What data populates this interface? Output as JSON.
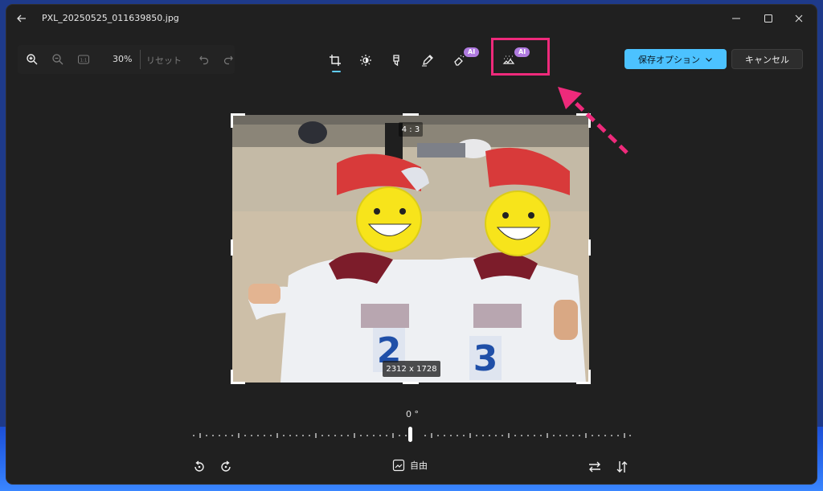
{
  "titlebar": {
    "filename": "PXL_20250525_011639850.jpg",
    "back_icon": "arrow-left-icon",
    "minimize_icon": "minimize-icon",
    "maximize_icon": "maximize-icon",
    "close_icon": "close-icon"
  },
  "zoom_toolbar": {
    "zoom_in_icon": "zoom-in-icon",
    "zoom_out_icon": "zoom-out-icon",
    "actual_size_icon": "actual-size-icon",
    "zoom_percent": "30%",
    "reset_label": "リセット",
    "undo_icon": "undo-icon",
    "redo_icon": "redo-icon"
  },
  "edit_tools": [
    {
      "name": "crop",
      "icon": "crop-icon",
      "active": true
    },
    {
      "name": "adjust",
      "icon": "brightness-icon"
    },
    {
      "name": "filter",
      "icon": "filter-icon"
    },
    {
      "name": "markup",
      "icon": "pen-icon"
    },
    {
      "name": "erase",
      "icon": "generative-erase-icon",
      "badge": "AI"
    },
    {
      "name": "background",
      "icon": "background-blur-icon",
      "badge": "AI"
    }
  ],
  "actions": {
    "save_label": "保存オプション",
    "cancel_label": "キャンセル"
  },
  "crop": {
    "ratio": "4 : 3",
    "dimensions": "2312 x 1728",
    "angle": "0 °",
    "free_label": "自由"
  },
  "colors": {
    "accent": "#4cc2ff",
    "highlight": "#ee2a7b",
    "ai_badge": "#b07be0",
    "window_bg": "#202020"
  }
}
